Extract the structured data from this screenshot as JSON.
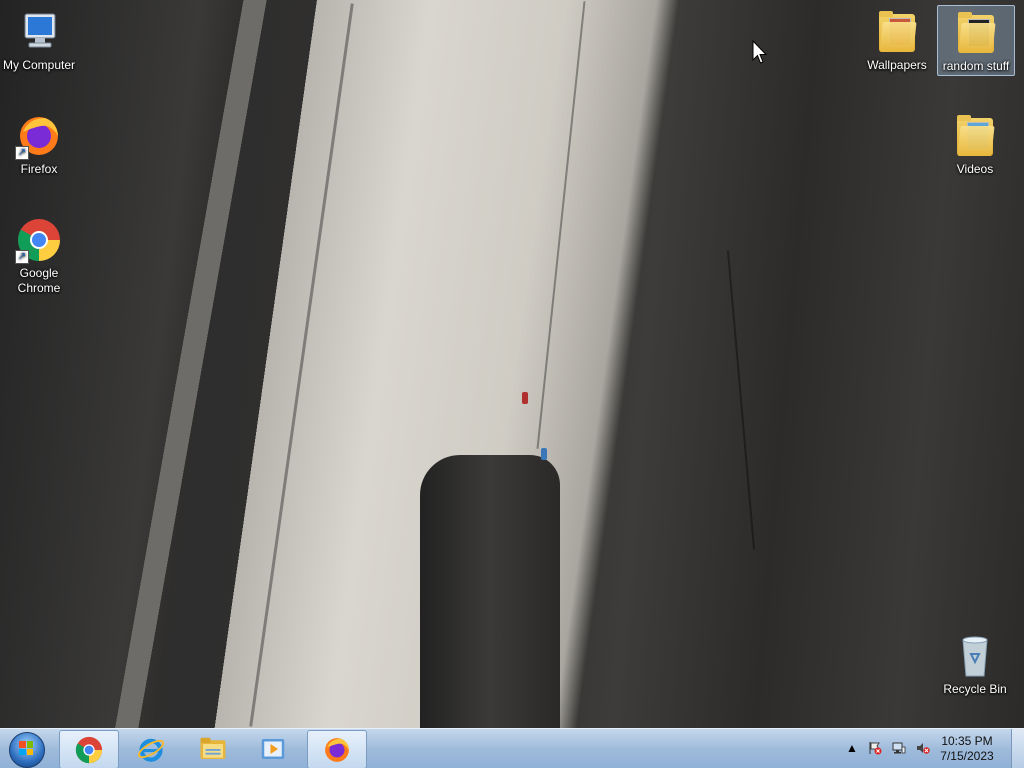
{
  "desktop": {
    "icons": [
      {
        "label": "My Computer",
        "icon": "computer-icon"
      },
      {
        "label": "Firefox",
        "icon": "firefox-icon"
      },
      {
        "label": "Google\nChrome",
        "icon": "chrome-icon"
      },
      {
        "label": "Wallpapers",
        "icon": "folder-icon"
      },
      {
        "label": "random stuff",
        "icon": "folder-icon",
        "selected": true
      },
      {
        "label": "Videos",
        "icon": "folder-icon"
      },
      {
        "label": "Recycle Bin",
        "icon": "recycle-bin-icon"
      }
    ]
  },
  "taskbar": {
    "start_icon": "windows-start-icon",
    "pinned": [
      {
        "name": "Google Chrome",
        "icon": "chrome-icon",
        "active": true
      },
      {
        "name": "Internet Explorer",
        "icon": "internet-explorer-icon",
        "active": false
      },
      {
        "name": "Windows Explorer",
        "icon": "folder-icon",
        "active": false
      },
      {
        "name": "Windows Media Player",
        "icon": "media-player-icon",
        "active": false
      },
      {
        "name": "Firefox",
        "icon": "firefox-icon",
        "active": true
      }
    ],
    "tray": {
      "icons": [
        "show-hidden-icons-arrow-icon",
        "action-center-flag-icon",
        "network-icon",
        "volume-muted-icon"
      ],
      "time": "10:35 PM",
      "date": "7/15/2023"
    }
  },
  "colors": {
    "taskbar": "#9fbbdb",
    "selection": "#aac8eb"
  }
}
